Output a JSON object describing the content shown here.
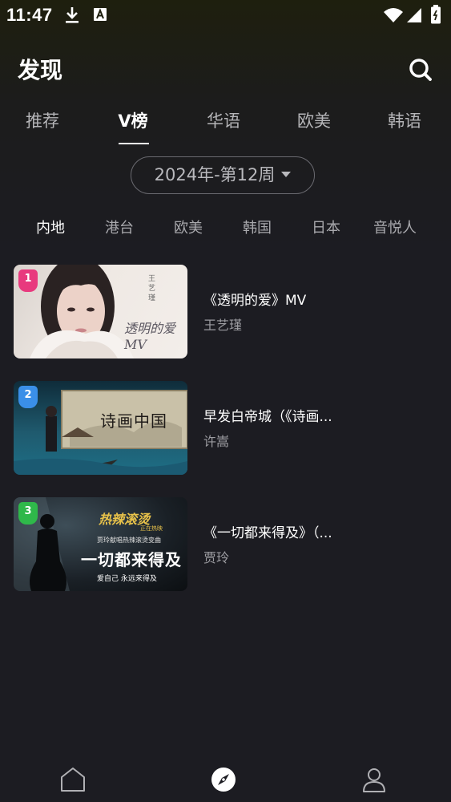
{
  "status_bar": {
    "time": "11:47",
    "icons": [
      "download-icon",
      "font-icon",
      "wifi-icon",
      "signal-icon",
      "battery-icon"
    ]
  },
  "header": {
    "title": "发现",
    "icon": "search-icon"
  },
  "tabs": [
    {
      "label": "推荐",
      "active": false
    },
    {
      "label": "V榜",
      "active": true
    },
    {
      "label": "华语",
      "active": false
    },
    {
      "label": "欧美",
      "active": false
    },
    {
      "label": "韩语",
      "active": false
    }
  ],
  "week_selector": {
    "label": "2024年-第12周"
  },
  "regions": [
    {
      "label": "内地",
      "active": true
    },
    {
      "label": "港台",
      "active": false
    },
    {
      "label": "欧美",
      "active": false
    },
    {
      "label": "韩国",
      "active": false
    },
    {
      "label": "日本",
      "active": false
    },
    {
      "label": "音悦人",
      "active": false
    }
  ],
  "mv_list": [
    {
      "rank": "1",
      "rank_color": "#e83a7e",
      "title": "《透明的爱》MV",
      "artist": "王艺瑾",
      "thumb_overlay_text": "透明的爱MV",
      "thumb_side_text": "王艺瑾"
    },
    {
      "rank": "2",
      "rank_color": "#3a8fe8",
      "title": "早发白帝城（《诗画...",
      "artist": "许嵩",
      "thumb_overlay_text": "诗画中国"
    },
    {
      "rank": "3",
      "rank_color": "#2fb84a",
      "title": "《一切都来得及》（...",
      "artist": "贾玲",
      "thumb_overlay_text": "一切都来得及",
      "thumb_top_text": "热辣滚烫",
      "thumb_top_sub": "正在热映",
      "thumb_mid_text": "贾玲献唱热辣滚烫变曲",
      "thumb_bottom_text": "爱自己 永远来得及"
    }
  ],
  "bottom_nav": [
    {
      "icon": "home-icon",
      "active": false
    },
    {
      "icon": "discover-icon",
      "active": true
    },
    {
      "icon": "profile-icon",
      "active": false
    }
  ]
}
